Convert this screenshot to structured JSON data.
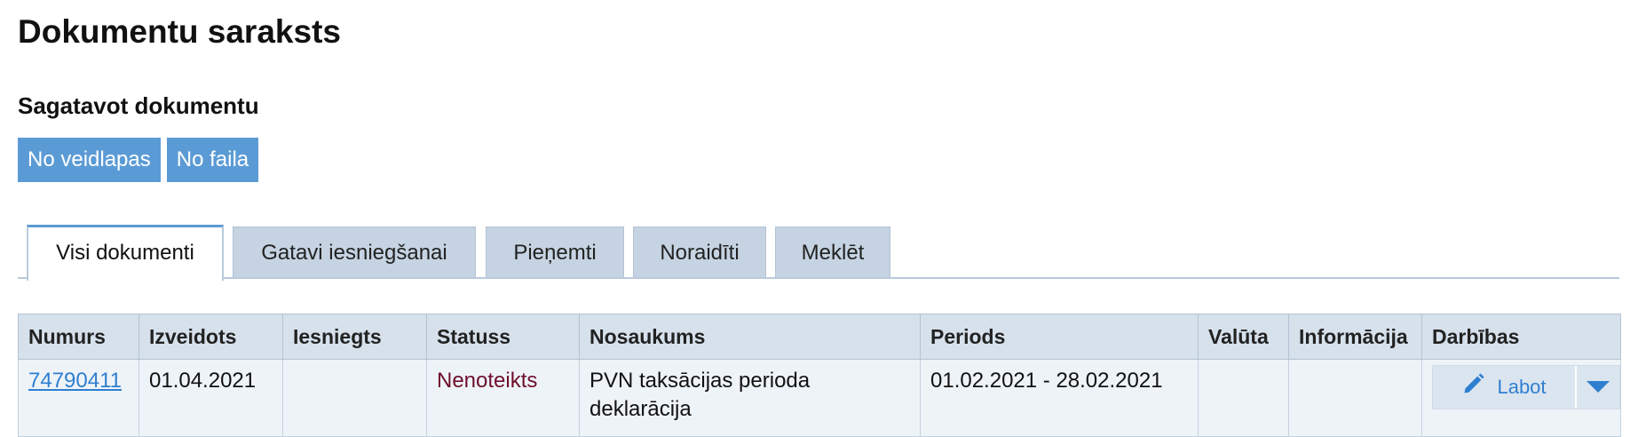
{
  "page": {
    "title": "Dokumentu saraksts"
  },
  "create": {
    "title": "Sagatavot dokumentu",
    "from_template_label": "No veidlapas",
    "from_file_label": "No faila"
  },
  "tabs": [
    {
      "label": "Visi dokumenti",
      "active": true
    },
    {
      "label": "Gatavi iesniegšanai",
      "active": false
    },
    {
      "label": "Pieņemti",
      "active": false
    },
    {
      "label": "Noraidīti",
      "active": false
    },
    {
      "label": "Meklēt",
      "active": false
    }
  ],
  "table": {
    "columns": [
      "Numurs",
      "Izveidots",
      "Iesniegts",
      "Statuss",
      "Nosaukums",
      "Periods",
      "Valūta",
      "Informācija",
      "Darbības"
    ],
    "rows": [
      {
        "number": "74790411",
        "created": "01.04.2021",
        "submitted": "",
        "status": "Nenoteikts",
        "name": "PVN taksācijas perioda deklarācija",
        "period": "01.02.2021 - 28.02.2021",
        "currency": "",
        "info": "",
        "action_label": "Labot"
      }
    ]
  },
  "colors": {
    "accent": "#5b9bd5",
    "link": "#2f7fd0",
    "status": "#6e0f2b",
    "header_bg": "#d6e1ec",
    "row_bg": "#eef3f8",
    "tab_bg": "#c5d3e2"
  },
  "icons": {
    "edit": "pencil-icon",
    "menu": "caret-down-icon"
  }
}
